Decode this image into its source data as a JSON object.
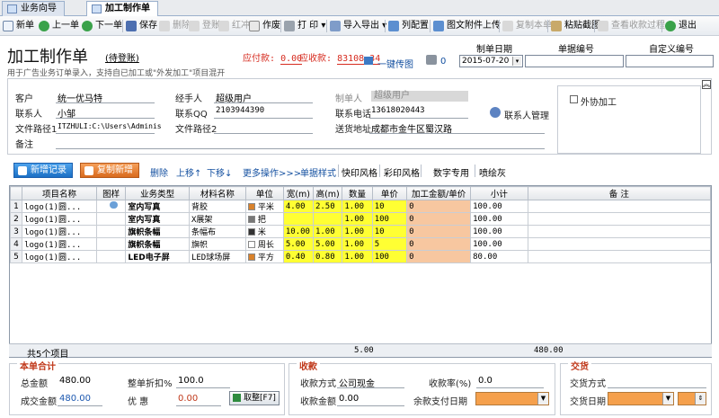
{
  "tabs": [
    {
      "label": "业务向导"
    },
    {
      "label": "加工制作单"
    }
  ],
  "toolbar": {
    "new": "新单",
    "prev": "上一单",
    "next": "下一单",
    "save": "保存",
    "delete": "删除",
    "login": "登账",
    "red": "红冲",
    "void": "作废",
    "print": "打 印",
    "import_export": "导入导出",
    "column_config": "列配置",
    "attach_upload": "图文附件上传",
    "copy": "复制本单",
    "paste_image": "粘贴截图",
    "view_receipts": "查看收款过程",
    "exit": "退出"
  },
  "header": {
    "title": "加工制作单",
    "status": "(待登账)",
    "subtitle": "用于广告业务订单录入，支持自已加工或\"外发加工\"项目混开",
    "payable_label": "应付款:",
    "payable_value": "0.00",
    "receivable_label": "应收款:",
    "receivable_value": "83108.34",
    "upload_label": "一键传图",
    "image_count": "0",
    "date_label": "制单日期",
    "date_value": "2015-07-20",
    "docno_label": "单据编号",
    "docno_value": "",
    "custom_label": "自定义编号",
    "custom_value": ""
  },
  "form": {
    "customer_label": "客户",
    "customer_value": "统一优马特",
    "manager_label": "经手人",
    "manager_value": "超级用户",
    "creator_label": "制单人",
    "creator_value": "超级用户",
    "contact_label": "联系人",
    "contact_value": "小邹",
    "qq_label": "联系QQ",
    "qq_value": "2103944390",
    "phone_label": "联系电话",
    "phone_value": "13618020443",
    "path1_label": "文件路径1",
    "path1_value": "ITZHULI:C:\\Users\\Adminis",
    "path2_label": "文件路径2",
    "path2_value": "",
    "address_label": "送货地址",
    "address_value": "成都市金牛区蜀汉路",
    "note_label": "备注",
    "note_value": "",
    "contact_mgmt": "联系人管理",
    "outsource_label": "外协加工"
  },
  "grid_toolbar": {
    "add": "新增记录",
    "copy_add": "复制新增",
    "delete": "删除",
    "up": "上移↑",
    "down": "下移↓",
    "more": "更多操作>>>",
    "style_single": "单据样式",
    "style_fast": "快印风格",
    "style_color": "彩印风格",
    "style_digital": "数字专用",
    "style_jet": "喷绘灰"
  },
  "columns": [
    "项目名称",
    "图样",
    "业务类型",
    "材料名称",
    "单位",
    "宽(m)",
    "高(m)",
    "数量",
    "单价",
    "加工金额/单价",
    "小计",
    "备 注"
  ],
  "rows": [
    {
      "n": "1",
      "name": "logo(1)圆...",
      "type": "室内写真",
      "material": "背胶",
      "unit": "平米",
      "unit_color": "#d9822b",
      "w": "4.00",
      "h": "2.50",
      "qty": "1.00",
      "price": "10",
      "proc": "0",
      "subtotal": "100.00",
      "note": ""
    },
    {
      "n": "2",
      "name": "logo(1)圆...",
      "type": "室内写真",
      "material": "X展架",
      "unit": "把",
      "unit_color": "#777777",
      "w": "",
      "h": "",
      "qty": "1.00",
      "price": "100",
      "proc": "0",
      "subtotal": "100.00",
      "note": ""
    },
    {
      "n": "3",
      "name": "logo(1)圆...",
      "type": "旗帜条幅",
      "material": "条幅布",
      "unit": "米",
      "unit_color": "#333333",
      "w": "10.00",
      "h": "1.00",
      "qty": "1.00",
      "price": "10",
      "proc": "0",
      "subtotal": "100.00",
      "note": ""
    },
    {
      "n": "4",
      "name": "logo(1)圆...",
      "type": "旗帜条幅",
      "material": "旗帜",
      "unit": "周长",
      "unit_color": "#ffffff",
      "w": "5.00",
      "h": "5.00",
      "qty": "1.00",
      "price": "5",
      "proc": "0",
      "subtotal": "100.00",
      "note": ""
    },
    {
      "n": "5",
      "name": "logo(1)圆...",
      "type": "LED电子屏",
      "material": "LED球场屏",
      "unit": "平方",
      "unit_color": "#d9822b",
      "w": "0.40",
      "h": "0.80",
      "qty": "1.00",
      "price": "100",
      "proc": "0",
      "subtotal": "80.00",
      "note": ""
    }
  ],
  "footer_row": {
    "count": "共5个项目",
    "qty_total": "5.00",
    "sum_total": "480.00"
  },
  "summary": {
    "title": "本单合计",
    "total_label": "总金额",
    "total_value": "480.00",
    "discount_label": "整单折扣%",
    "discount_value": "100.0",
    "deal_label": "成交金额",
    "deal_value": "480.00",
    "benefit_label": "优 惠",
    "benefit_value": "0.00",
    "round_btn": "取整[F7]"
  },
  "payment": {
    "title": "收款",
    "method_label": "收款方式",
    "method_value": "公司现金",
    "rate_label": "收款率(%)",
    "rate_value": "0.0",
    "amount_label": "收款金额",
    "amount_value": "0.00",
    "due_label": "余款支付日期"
  },
  "delivery": {
    "title": "交货",
    "method_label": "交货方式",
    "date_label": "交货日期"
  }
}
